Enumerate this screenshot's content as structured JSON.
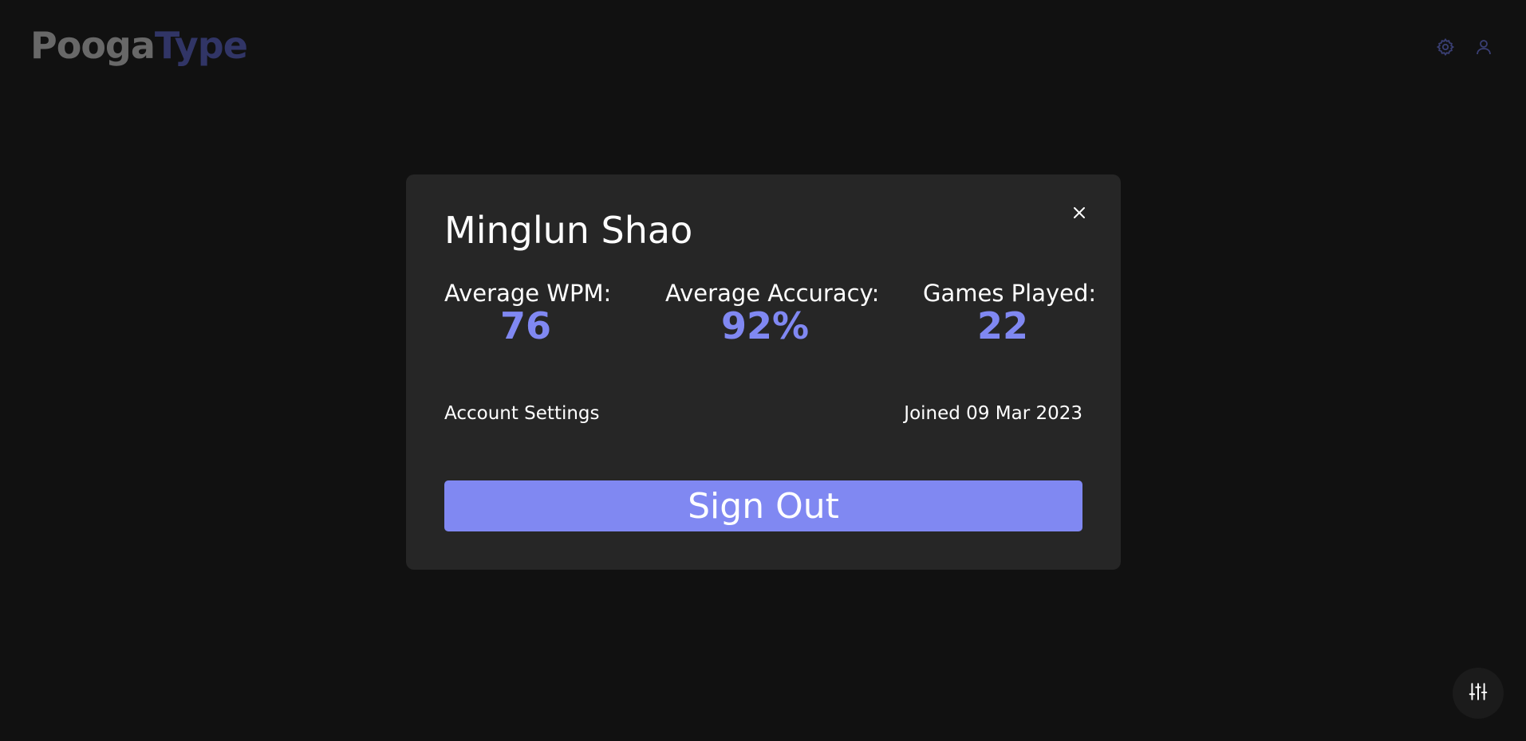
{
  "header": {
    "logo_part1": "Pooga",
    "logo_part2": "Type",
    "settings_icon": "gear-icon",
    "profile_icon": "user-icon"
  },
  "modal": {
    "user_name": "Minglun Shao",
    "close_icon": "close-icon",
    "stats": {
      "wpm_label": "Average WPM:",
      "wpm_value": "76",
      "accuracy_label": "Average Accuracy:",
      "accuracy_value": "92%",
      "games_label": "Games Played:",
      "games_value": "22"
    },
    "account_settings_label": "Account Settings",
    "joined_text": "Joined 09 Mar 2023",
    "signout_label": "Sign Out"
  },
  "fab": {
    "icon": "sliders-icon"
  },
  "colors": {
    "background": "#111111",
    "modal_bg": "#262626",
    "accent": "#8088f2",
    "logo_muted": "#686868",
    "logo_dark_accent": "#313566"
  }
}
